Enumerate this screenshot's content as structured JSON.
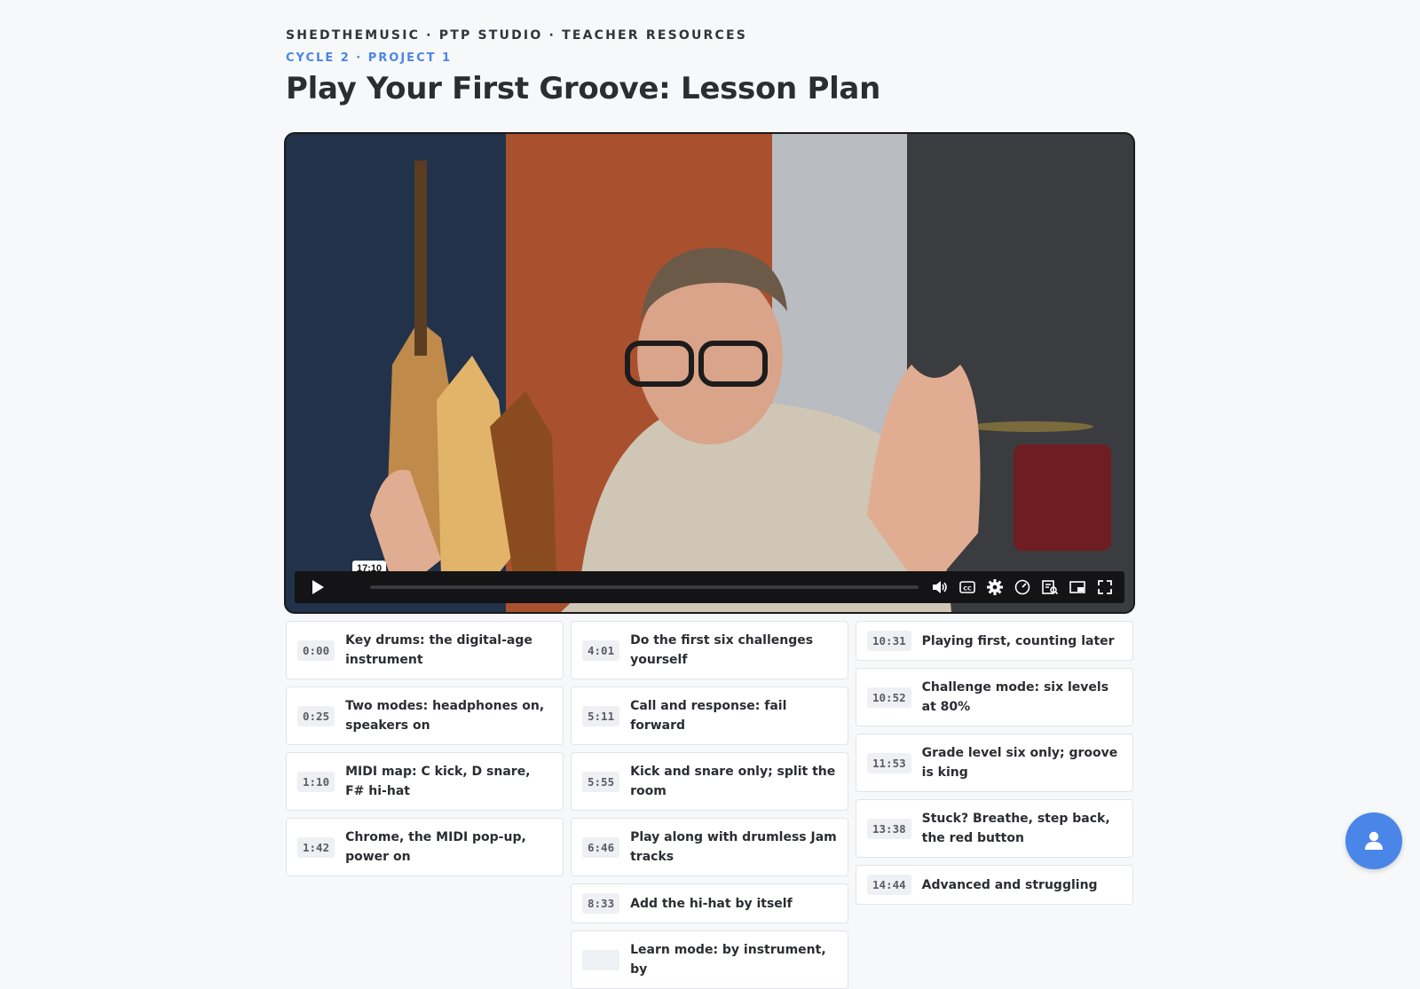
{
  "header": {
    "breadcrumb": "SHEDTHEMUSIC · PTP STUDIO · TEACHER RESOURCES",
    "eyebrow": "CYCLE 2 · PROJECT 1",
    "title": "Play Your First Groove: Lesson Plan"
  },
  "video": {
    "hover_time": "17:10",
    "progress": 0,
    "icons": [
      "play-icon",
      "volume-icon",
      "captions-icon",
      "settings-icon",
      "speed-icon",
      "transcript-icon",
      "picture-in-picture-icon",
      "fullscreen-icon"
    ]
  },
  "chapters": {
    "col1": [
      {
        "time": "0:00",
        "label": "Key drums: the digital-age instrument"
      },
      {
        "time": "0:25",
        "label": "Two modes: headphones on, speakers on"
      },
      {
        "time": "1:10",
        "label": "MIDI map: C kick, D snare, F# hi-hat"
      },
      {
        "time": "1:42",
        "label": "Chrome, the MIDI pop-up, power on"
      }
    ],
    "col2": [
      {
        "time": "4:01",
        "label": "Do the first six challenges yourself"
      },
      {
        "time": "5:11",
        "label": "Call and response: fail forward"
      },
      {
        "time": "5:55",
        "label": "Kick and snare only; split the room"
      },
      {
        "time": "6:46",
        "label": "Play along with drumless Jam tracks"
      },
      {
        "time": "8:33",
        "label": "Add the hi-hat by itself"
      },
      {
        "time": "",
        "label": "Learn mode: by instrument, by"
      }
    ],
    "col3": [
      {
        "time": "10:31",
        "label": "Playing first, counting later"
      },
      {
        "time": "10:52",
        "label": "Challenge mode: six levels at 80%"
      },
      {
        "time": "11:53",
        "label": "Grade level six only; groove is king"
      },
      {
        "time": "13:38",
        "label": "Stuck? Breathe, step back, the red button"
      },
      {
        "time": "14:44",
        "label": "Advanced and struggling"
      }
    ]
  },
  "colors": {
    "accent": "#4a86e8",
    "background": "#f7f8fa",
    "text": "#2b2d31"
  },
  "fab": {
    "icon": "user-icon"
  }
}
